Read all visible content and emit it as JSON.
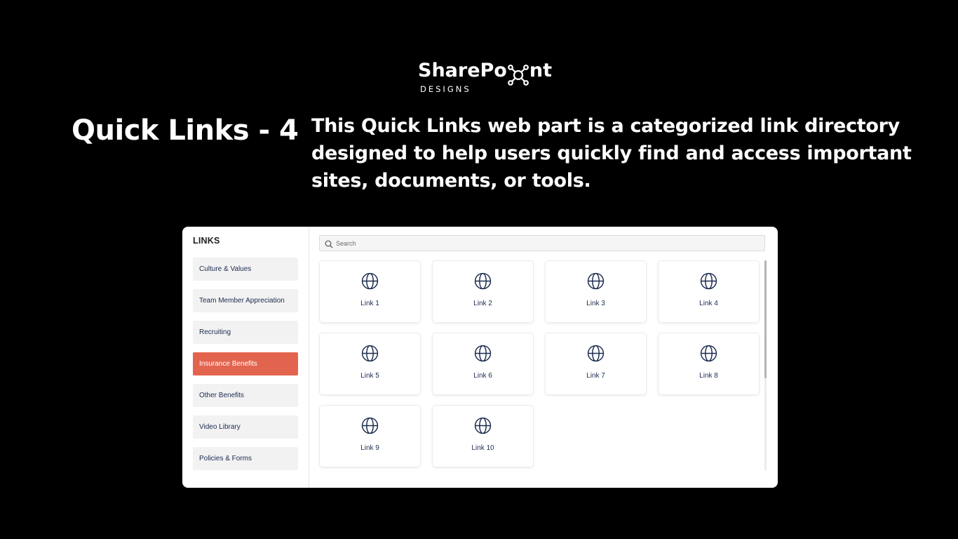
{
  "brand": {
    "name_part1": "SharePo",
    "name_part2": "nt",
    "subtitle": "DESIGNS",
    "logo_icon": "network-node-icon"
  },
  "hero": {
    "title": "Quick Links - 4",
    "description": "This Quick Links web part is a categorized link directory designed to help users quickly find and access important sites, documents, or tools."
  },
  "webpart": {
    "sidebar_title": "LINKS",
    "categories": [
      {
        "label": "Culture & Values",
        "active": false
      },
      {
        "label": "Team Member Appreciation",
        "active": false
      },
      {
        "label": "Recruiting",
        "active": false
      },
      {
        "label": "Insurance Benefits",
        "active": true
      },
      {
        "label": "Other Benefits",
        "active": false
      },
      {
        "label": "Video Library",
        "active": false
      },
      {
        "label": "Policies & Forms",
        "active": false
      }
    ],
    "search": {
      "placeholder": "Search",
      "value": "",
      "icon": "search-icon"
    },
    "links": [
      {
        "label": "Link 1",
        "icon": "globe-icon"
      },
      {
        "label": "Link 2",
        "icon": "globe-icon"
      },
      {
        "label": "Link 3",
        "icon": "globe-icon"
      },
      {
        "label": "Link 4",
        "icon": "globe-icon"
      },
      {
        "label": "Link 5",
        "icon": "globe-icon"
      },
      {
        "label": "Link 6",
        "icon": "globe-icon"
      },
      {
        "label": "Link 7",
        "icon": "globe-icon"
      },
      {
        "label": "Link 8",
        "icon": "globe-icon"
      },
      {
        "label": "Link 9",
        "icon": "globe-icon"
      },
      {
        "label": "Link 10",
        "icon": "globe-icon"
      }
    ]
  },
  "colors": {
    "background": "#000000",
    "card": "#ffffff",
    "accent": "#e3644e",
    "text_dark": "#1c2a4f",
    "category_bg": "#f2f2f2"
  }
}
